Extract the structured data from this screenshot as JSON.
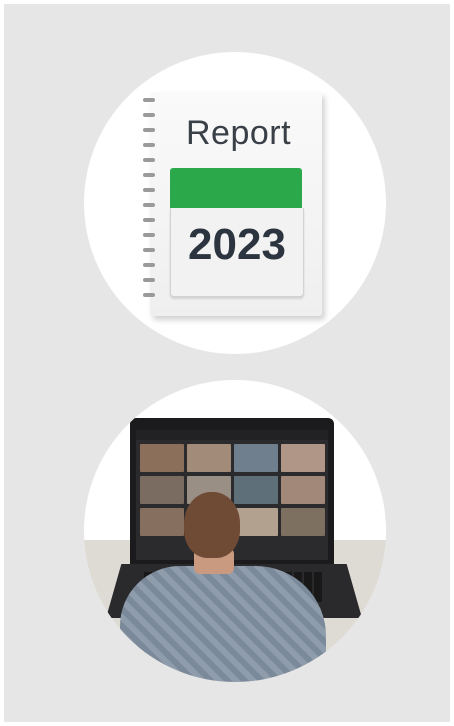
{
  "report_card": {
    "title_word": "Report",
    "year": "2023",
    "accent_color": "#2aa84a"
  },
  "video_call_card": {
    "icon": "video-conference-photo",
    "tile_colors": [
      "#8c6f5a",
      "#a38b7a",
      "#6f7f8e",
      "#b09686",
      "#7a6c60",
      "#9a8f84",
      "#5f6f7a",
      "#a18878",
      "#866f5e",
      "#6a7a88",
      "#b3a190",
      "#7e7060"
    ]
  }
}
